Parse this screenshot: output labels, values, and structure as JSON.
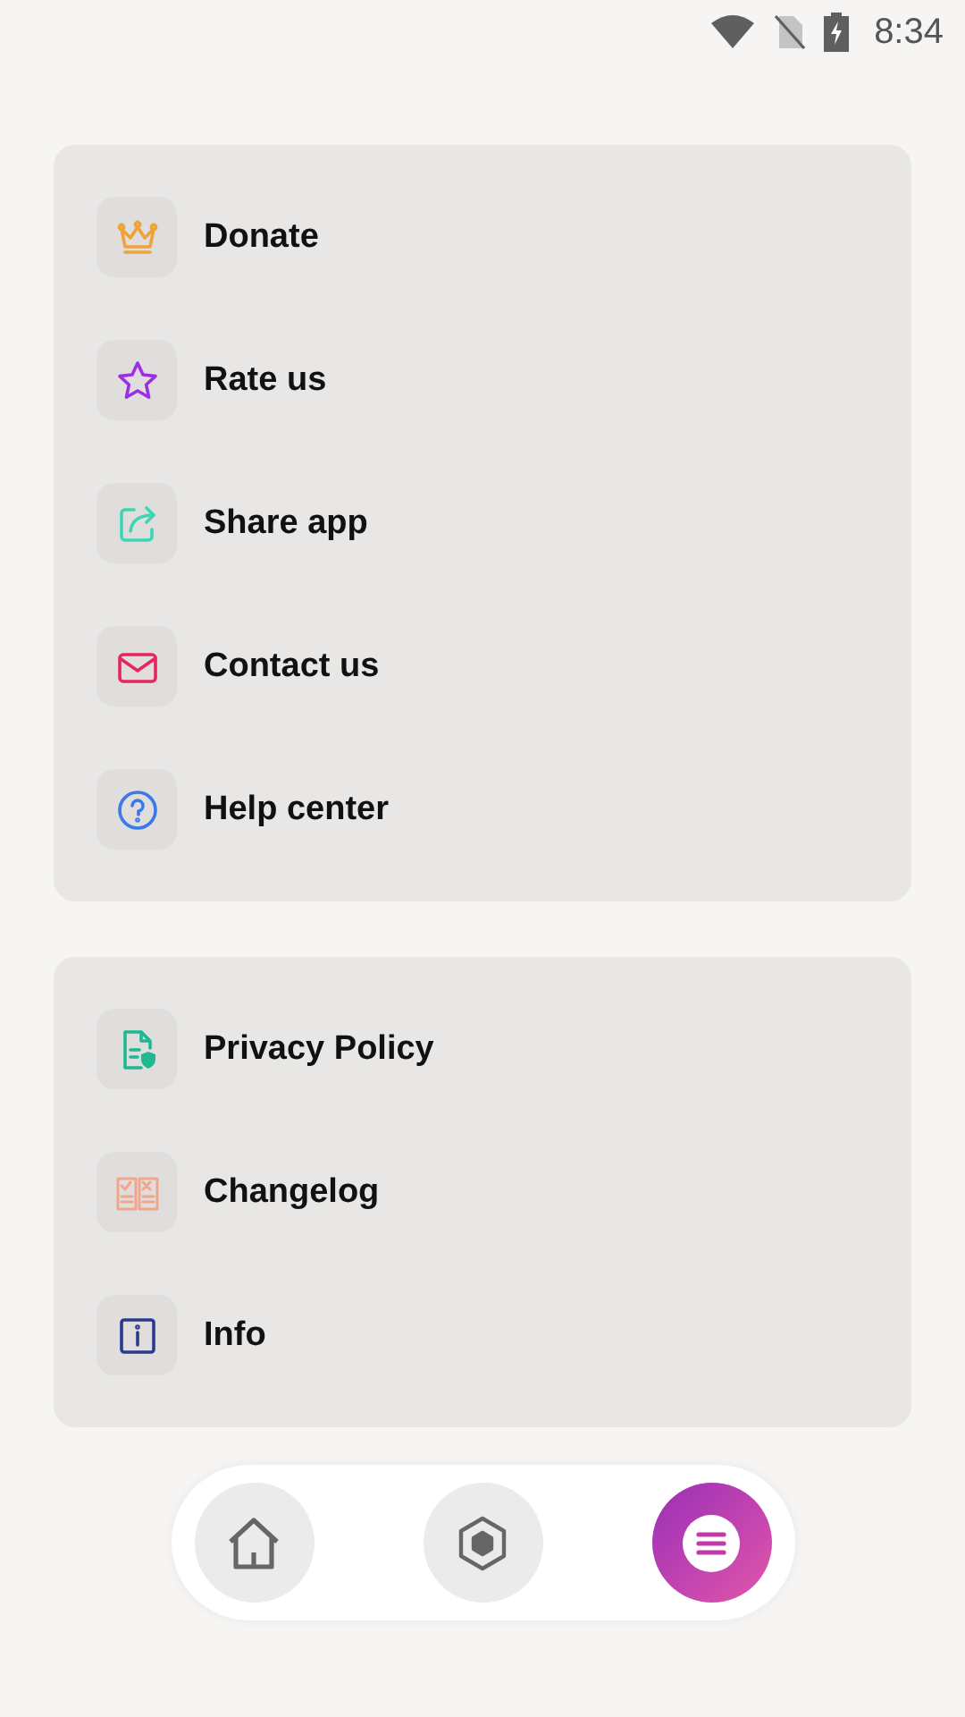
{
  "status_bar": {
    "time": "8:34"
  },
  "groups": [
    {
      "items": [
        {
          "label": "Donate"
        },
        {
          "label": "Rate us"
        },
        {
          "label": "Share app"
        },
        {
          "label": "Contact us"
        },
        {
          "label": "Help center"
        }
      ]
    },
    {
      "items": [
        {
          "label": "Privacy Policy"
        },
        {
          "label": "Changelog"
        },
        {
          "label": "Info"
        }
      ]
    }
  ],
  "nav": [
    {
      "selected": false
    },
    {
      "selected": false
    },
    {
      "selected": true
    }
  ]
}
